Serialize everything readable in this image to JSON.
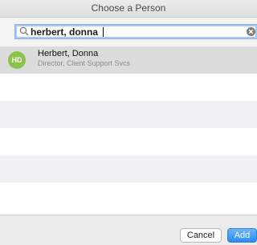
{
  "dialog": {
    "title": "Choose a Person"
  },
  "search": {
    "value": "herbert, donna"
  },
  "results": [
    {
      "initials": "HD",
      "name": "Herbert, Donna",
      "subtitle": "Director, Client Support Svcs",
      "avatar_color": "#8bc34a"
    }
  ],
  "footer": {
    "cancel_label": "Cancel",
    "add_label": "Add"
  },
  "colors": {
    "accent": "#2d8cf0",
    "selected_row": "#dcdcdc"
  }
}
